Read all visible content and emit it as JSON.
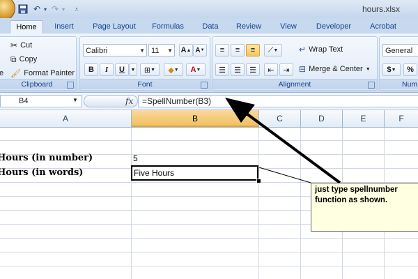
{
  "window": {
    "title": "hours.xlsx"
  },
  "tabs": [
    {
      "label": "Home",
      "active": true
    },
    {
      "label": "Insert"
    },
    {
      "label": "Page Layout"
    },
    {
      "label": "Formulas"
    },
    {
      "label": "Data"
    },
    {
      "label": "Review"
    },
    {
      "label": "View"
    },
    {
      "label": "Developer"
    },
    {
      "label": "Acrobat"
    }
  ],
  "ribbon": {
    "clipboard": {
      "label": "Clipboard",
      "cut": "Cut",
      "copy": "Copy",
      "format_painter": "Format Painter"
    },
    "font": {
      "label": "Font",
      "name": "Calibri",
      "size": "11",
      "bold": "B",
      "italic": "I",
      "underline": "U"
    },
    "alignment": {
      "label": "Alignment",
      "wrap_text": "Wrap Text",
      "merge_center": "Merge & Center"
    },
    "number": {
      "label": "Num",
      "format": "General",
      "currency": "$",
      "percent": "%"
    }
  },
  "formula_bar": {
    "name_box": "B4",
    "fx": "fx",
    "formula": "=SpellNumber(B3)"
  },
  "columns": [
    "A",
    "B",
    "C",
    "D",
    "E",
    "F"
  ],
  "selected_column": "B",
  "cells": {
    "A3": "Hours (in number)",
    "A4": "Hours (in words)",
    "B3": "5",
    "B4": "Five Hours"
  },
  "comment": {
    "text": "just type spellnumber function as shown."
  },
  "colors": {
    "accent": "#15428b",
    "selected_header": "#f1c15f",
    "comment_bg": "#ffffe1"
  }
}
